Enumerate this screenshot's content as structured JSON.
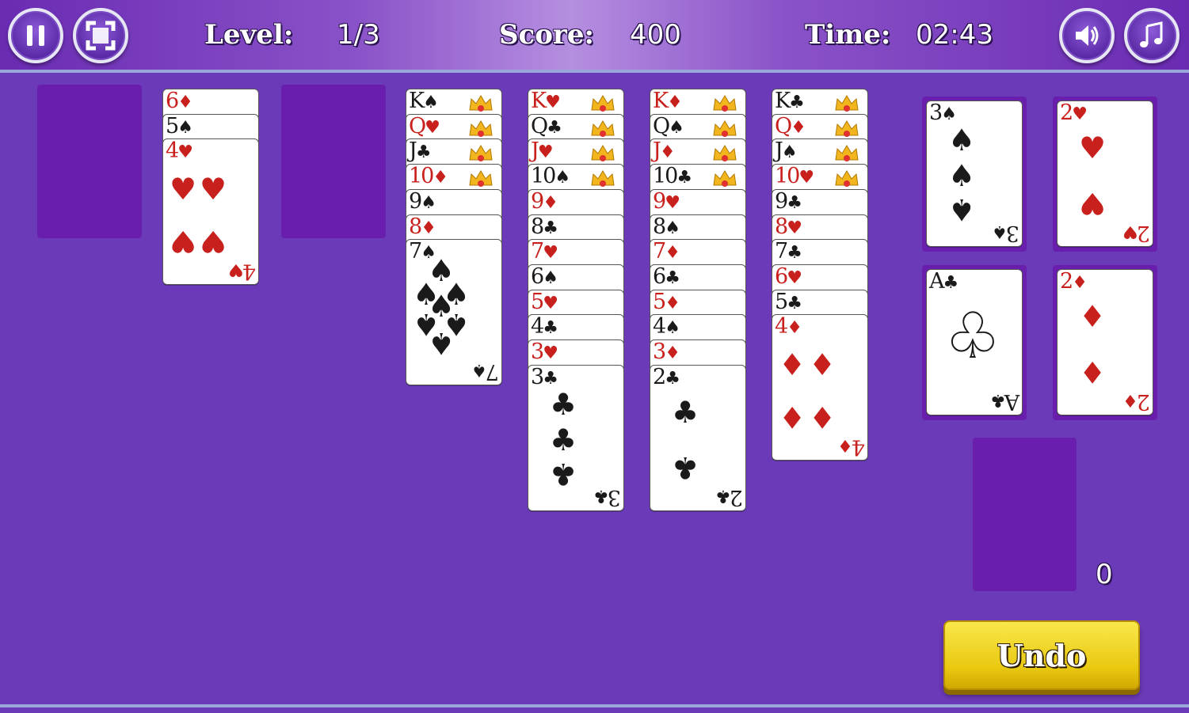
{
  "hud": {
    "level_label": "Level:",
    "level_value": "1/3",
    "score_label": "Score:",
    "score_value": "400",
    "time_label": "Time:",
    "time_value": "02:43"
  },
  "buttons": {
    "pause_icon": "pause-icon",
    "fullscreen_icon": "fullscreen-icon",
    "sound_icon": "speaker-icon",
    "music_icon": "music-note-icon",
    "undo_label": "Undo"
  },
  "stock_count": "0",
  "colors": {
    "background": "#6a3ab8",
    "slot": "#6a1eae",
    "red_suit": "#c8201c",
    "undo": "#e9c810"
  },
  "tableau": [
    {
      "column": 2,
      "cards": [
        {
          "rank": "6",
          "suit": "♦"
        },
        {
          "rank": "5",
          "suit": "♠"
        },
        {
          "rank": "4",
          "suit": "♥"
        }
      ]
    },
    {
      "column": 4,
      "cards": [
        {
          "rank": "K",
          "suit": "♠"
        },
        {
          "rank": "Q",
          "suit": "♥"
        },
        {
          "rank": "J",
          "suit": "♣"
        },
        {
          "rank": "10",
          "suit": "♦"
        },
        {
          "rank": "9",
          "suit": "♠"
        },
        {
          "rank": "8",
          "suit": "♦"
        },
        {
          "rank": "7",
          "suit": "♠"
        }
      ]
    },
    {
      "column": 5,
      "cards": [
        {
          "rank": "K",
          "suit": "♥"
        },
        {
          "rank": "Q",
          "suit": "♣"
        },
        {
          "rank": "J",
          "suit": "♥"
        },
        {
          "rank": "10",
          "suit": "♠"
        },
        {
          "rank": "9",
          "suit": "♦"
        },
        {
          "rank": "8",
          "suit": "♣"
        },
        {
          "rank": "7",
          "suit": "♥"
        },
        {
          "rank": "6",
          "suit": "♠"
        },
        {
          "rank": "5",
          "suit": "♥"
        },
        {
          "rank": "4",
          "suit": "♣"
        },
        {
          "rank": "3",
          "suit": "♥"
        },
        {
          "rank": "3",
          "suit": "♣"
        }
      ]
    },
    {
      "column": 6,
      "cards": [
        {
          "rank": "K",
          "suit": "♦"
        },
        {
          "rank": "Q",
          "suit": "♠"
        },
        {
          "rank": "J",
          "suit": "♦"
        },
        {
          "rank": "10",
          "suit": "♣"
        },
        {
          "rank": "9",
          "suit": "♥"
        },
        {
          "rank": "8",
          "suit": "♠"
        },
        {
          "rank": "7",
          "suit": "♦"
        },
        {
          "rank": "6",
          "suit": "♣"
        },
        {
          "rank": "5",
          "suit": "♦"
        },
        {
          "rank": "4",
          "suit": "♠"
        },
        {
          "rank": "3",
          "suit": "♦"
        },
        {
          "rank": "2",
          "suit": "♣"
        }
      ]
    },
    {
      "column": 7,
      "cards": [
        {
          "rank": "K",
          "suit": "♣"
        },
        {
          "rank": "Q",
          "suit": "♦"
        },
        {
          "rank": "J",
          "suit": "♠"
        },
        {
          "rank": "10",
          "suit": "♥"
        },
        {
          "rank": "9",
          "suit": "♣"
        },
        {
          "rank": "8",
          "suit": "♥"
        },
        {
          "rank": "7",
          "suit": "♣"
        },
        {
          "rank": "6",
          "suit": "♥"
        },
        {
          "rank": "5",
          "suit": "♣"
        },
        {
          "rank": "4",
          "suit": "♦"
        }
      ]
    }
  ],
  "foundations": [
    {
      "rank": "3",
      "suit": "♠"
    },
    {
      "rank": "2",
      "suit": "♥"
    },
    {
      "rank": "A",
      "suit": "♣"
    },
    {
      "rank": "2",
      "suit": "♦"
    }
  ]
}
